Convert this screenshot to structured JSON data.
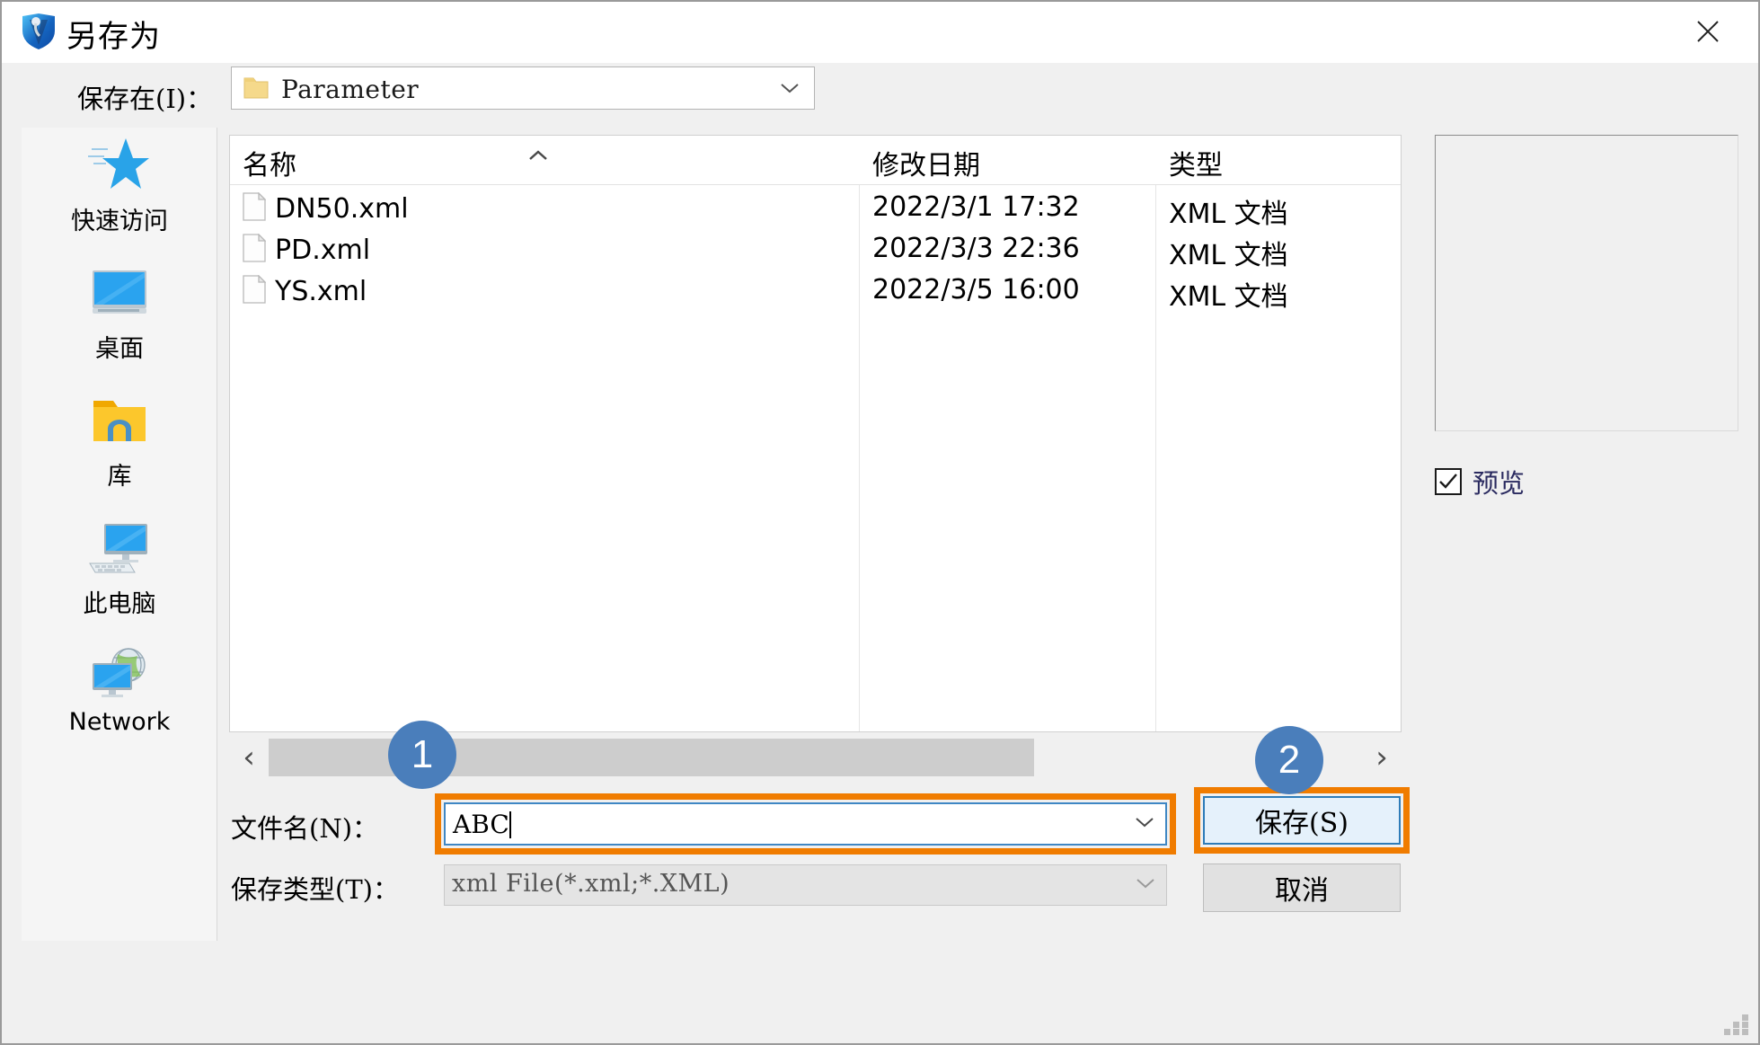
{
  "window": {
    "title": "另存为",
    "icon": "app-shield-icon",
    "close_label": "✕"
  },
  "path_bar": {
    "label": "保存在(I)：",
    "current_folder": "Parameter",
    "folder_icon": "folder-icon",
    "dropdown_icon": "chevron-down-icon",
    "toolbar": [
      {
        "name": "back-button",
        "icon": "back-arrow-icon"
      },
      {
        "name": "up-one-level-button",
        "icon": "up-folder-icon"
      },
      {
        "name": "new-folder-button",
        "icon": "new-folder-icon"
      },
      {
        "name": "views-button",
        "icon": "views-grid-icon"
      },
      {
        "name": "views-dropdown-button",
        "icon": "chevron-down-icon"
      }
    ]
  },
  "places": [
    {
      "label": "快速访问",
      "icon": "star-icon"
    },
    {
      "label": "桌面",
      "icon": "monitor-icon"
    },
    {
      "label": "库",
      "icon": "library-folder-icon"
    },
    {
      "label": "此电脑",
      "icon": "this-pc-icon"
    },
    {
      "label": "Network",
      "icon": "network-globe-icon"
    }
  ],
  "file_list": {
    "columns": [
      "名称",
      "修改日期",
      "类型"
    ],
    "sort_column": "名称",
    "sort_direction": "ascending",
    "sort_icon": "chevron-up-icon",
    "rows": [
      {
        "name": "DN50.xml",
        "modified": "2022/3/1 17:32",
        "type": "XML 文档",
        "icon": "file-icon"
      },
      {
        "name": "PD.xml",
        "modified": "2022/3/3 22:36",
        "type": "XML 文档",
        "icon": "file-icon"
      },
      {
        "name": "YS.xml",
        "modified": "2022/3/5 16:00",
        "type": "XML 文档",
        "icon": "file-icon"
      }
    ]
  },
  "scrollbar": {
    "left_arrow": "‹",
    "right_arrow": "›",
    "thumb_percent": 70
  },
  "form": {
    "filename_label": "文件名(N)：",
    "filename_value": "ABC",
    "filename_dropdown_icon": "chevron-down-icon",
    "filetype_label": "保存类型(T)：",
    "filetype_value": "xml File(*.xml;*.XML)",
    "filetype_dropdown_icon": "chevron-down-icon"
  },
  "buttons": {
    "save": "保存(S)",
    "cancel": "取消"
  },
  "preview": {
    "checkbox_label": "预览",
    "checked": true,
    "check_icon": "checkmark-icon",
    "pane_content": ""
  },
  "annotations": [
    {
      "badge": "1",
      "target": "filename-input"
    },
    {
      "badge": "2",
      "target": "save-button"
    }
  ],
  "colors": {
    "accent_orange": "#f07c00",
    "badge_blue": "#4a7ebb",
    "focus_blue": "#3f87c4",
    "save_button_fill": "#e5f1fb",
    "dialog_bg": "#f0f0f0"
  }
}
